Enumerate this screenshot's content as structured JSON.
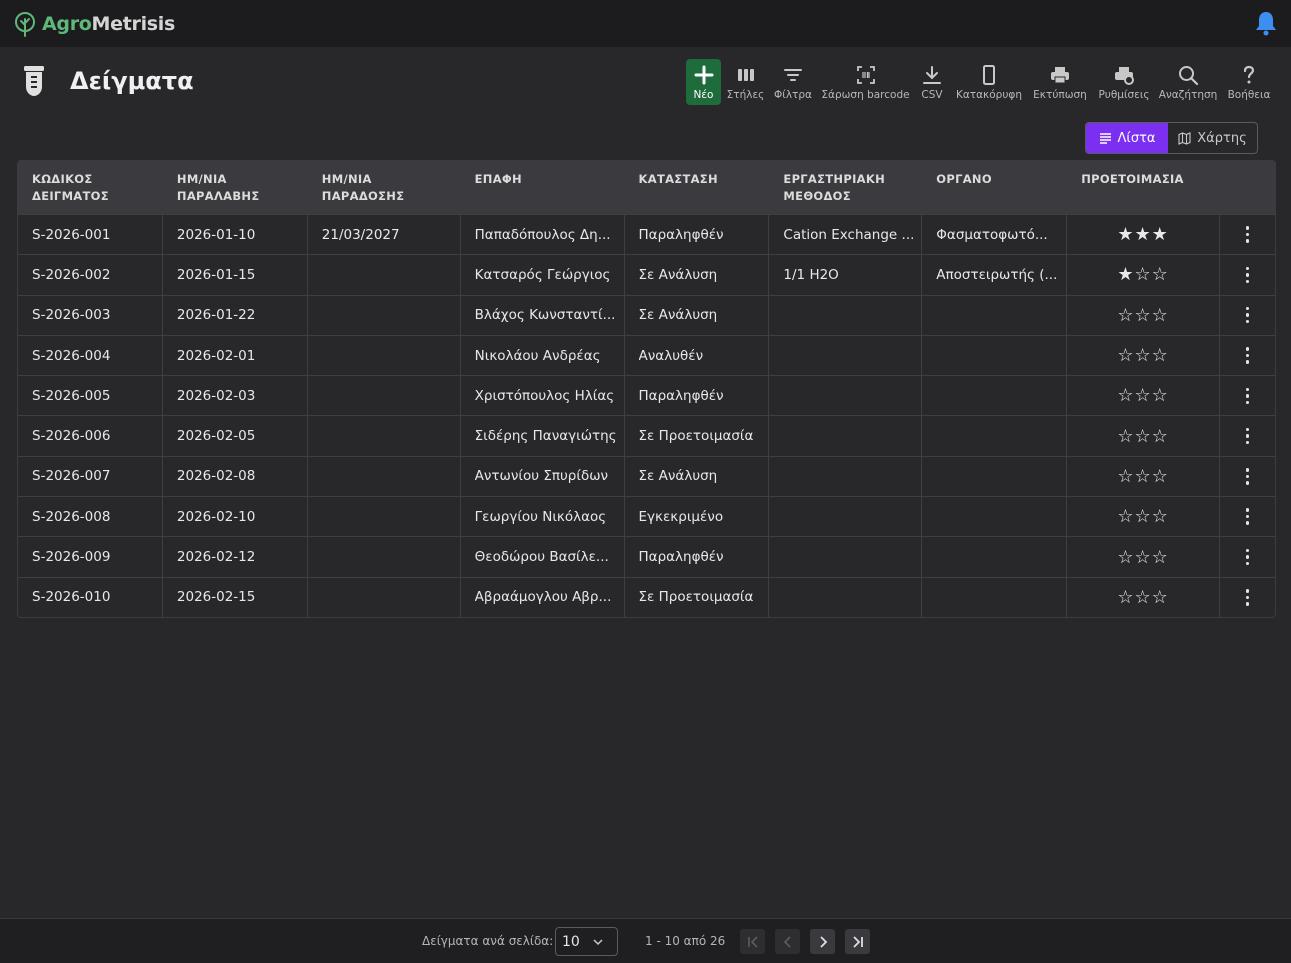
{
  "app": {
    "name_part1": "Agro",
    "name_part2": "Metrisis"
  },
  "page": {
    "title": "Δείγματα"
  },
  "toolbar": {
    "new": "Νέο",
    "columns": "Στήλες",
    "filters": "Φίλτρα",
    "barcode": "Σάρωση barcode",
    "csv": "CSV",
    "portrait": "Κατακόρυφη",
    "print": "Εκτύπωση",
    "settings": "Ρυθμίσεις",
    "search": "Αναζήτηση",
    "help": "Βοήθεια"
  },
  "view": {
    "list": "Λίστα",
    "map": "Χάρτης"
  },
  "table": {
    "headers": {
      "code_1": "ΚΩΔΙΚΟΣ",
      "code_2": "ΔΕΙΓΜΑΤΟΣ",
      "received_1": "ΗΜ/ΝΙΑ",
      "received_2": "ΠΑΡΑΛΑΒΗΣ",
      "delivery_1": "ΗΜ/ΝΙΑ",
      "delivery_2": "ΠΑΡΑΔΟΣΗΣ",
      "contact": "ΕΠΑΦΗ",
      "status": "ΚΑΤΑΣΤΑΣΗ",
      "method_1": "ΕΡΓΑΣΤΗΡΙΑΚΗ",
      "method_2": "ΜΕΘΟΔΟΣ",
      "instrument": "ΟΡΓΑΝΟ",
      "prep": "ΠΡΟΕΤΟΙΜΑΣΙΑ"
    },
    "rows": [
      {
        "code": "S-2026-001",
        "received": "2026-01-10",
        "delivery": "21/03/2027",
        "contact": "Παπαδόπουλος Δη...",
        "status": "Παραληφθέν",
        "method": "Cation Exchange ...",
        "instrument": "Φασματοφωτό...",
        "stars": "★★★"
      },
      {
        "code": "S-2026-002",
        "received": "2026-01-15",
        "delivery": "",
        "contact": "Κατσαρός Γεώργιος",
        "status": "Σε Ανάλυση",
        "method": "1/1 H2O",
        "instrument": "Αποστειρωτής (...",
        "stars": "★☆☆"
      },
      {
        "code": "S-2026-003",
        "received": "2026-01-22",
        "delivery": "",
        "contact": "Βλάχος Κωνσταντί...",
        "status": "Σε Ανάλυση",
        "method": "",
        "instrument": "",
        "stars": "☆☆☆"
      },
      {
        "code": "S-2026-004",
        "received": "2026-02-01",
        "delivery": "",
        "contact": "Νικολάου Ανδρέας",
        "status": "Αναλυθέν",
        "method": "",
        "instrument": "",
        "stars": "☆☆☆"
      },
      {
        "code": "S-2026-005",
        "received": "2026-02-03",
        "delivery": "",
        "contact": "Χριστόπουλος Ηλίας",
        "status": "Παραληφθέν",
        "method": "",
        "instrument": "",
        "stars": "☆☆☆"
      },
      {
        "code": "S-2026-006",
        "received": "2026-02-05",
        "delivery": "",
        "contact": "Σιδέρης Παναγιώτης",
        "status": "Σε Προετοιμασία",
        "method": "",
        "instrument": "",
        "stars": "☆☆☆"
      },
      {
        "code": "S-2026-007",
        "received": "2026-02-08",
        "delivery": "",
        "contact": "Αντωνίου Σπυρίδων",
        "status": "Σε Ανάλυση",
        "method": "",
        "instrument": "",
        "stars": "☆☆☆"
      },
      {
        "code": "S-2026-008",
        "received": "2026-02-10",
        "delivery": "",
        "contact": "Γεωργίου Νικόλαος",
        "status": "Εγκεκριμένο",
        "method": "",
        "instrument": "",
        "stars": "☆☆☆"
      },
      {
        "code": "S-2026-009",
        "received": "2026-02-12",
        "delivery": "",
        "contact": "Θεοδώρου Βασίλε...",
        "status": "Παραληφθέν",
        "method": "",
        "instrument": "",
        "stars": "☆☆☆"
      },
      {
        "code": "S-2026-010",
        "received": "2026-02-15",
        "delivery": "",
        "contact": "Αβραάμογλου Αβρ...",
        "status": "Σε Προετοιμασία",
        "method": "",
        "instrument": "",
        "stars": "☆☆☆"
      }
    ]
  },
  "pagination": {
    "per_page_label": "Δείγματα ανά σελίδα:",
    "per_page": "10",
    "range": "1 - 10 από 26"
  },
  "colors": {
    "accent": "#7b2ff0",
    "new_button": "#1e6b3c",
    "logo_green": "#5fb87a",
    "bell": "#3d8ef0"
  }
}
